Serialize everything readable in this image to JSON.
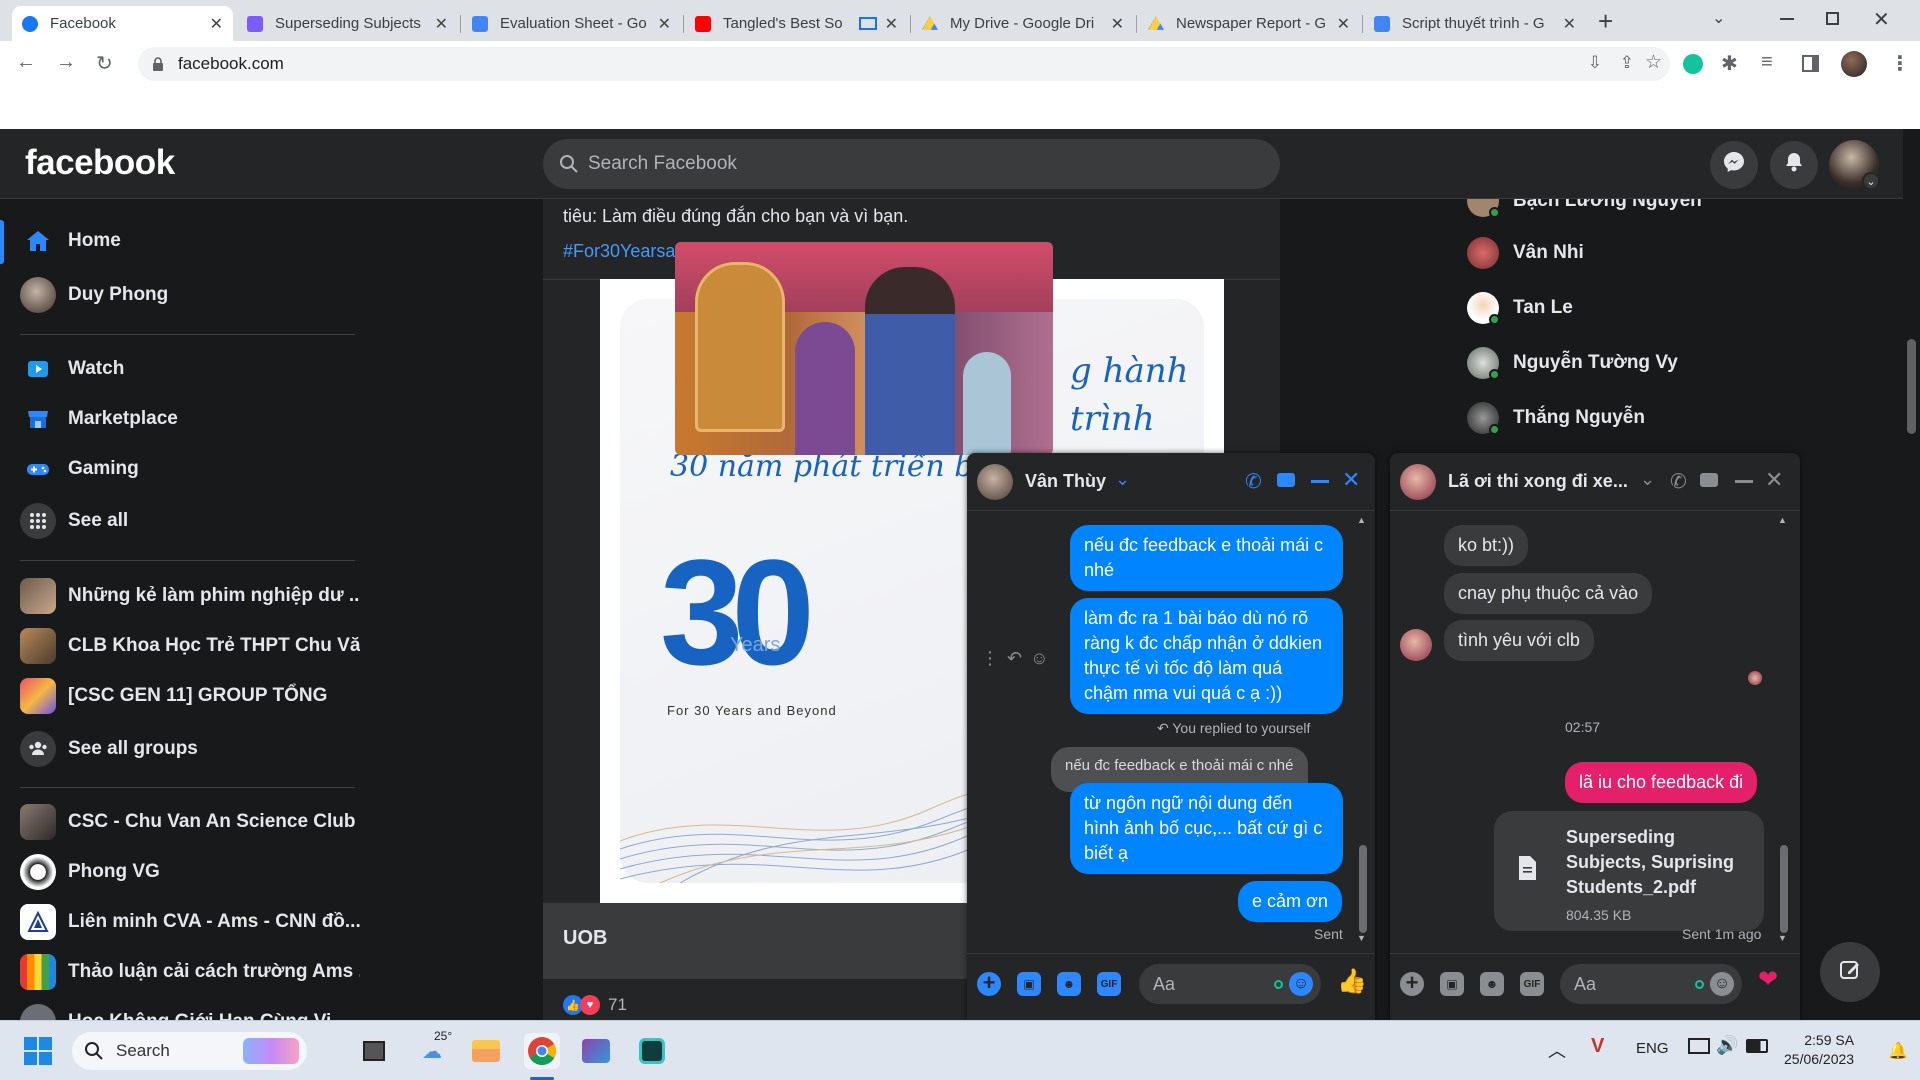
{
  "browser": {
    "tabs": [
      {
        "title": "Facebook",
        "icon_color": "#1877f2",
        "active": true
      },
      {
        "title": "Superseding Subjects",
        "icon_color": "#7b5cff"
      },
      {
        "title": "Evaluation Sheet - Go",
        "icon_color": "#4285f4"
      },
      {
        "title": "Tangled's Best So",
        "icon_color": "#ff0000"
      },
      {
        "title": "My Drive - Google Dri",
        "icon_color": "#34a853"
      },
      {
        "title": "Newspaper Report - G",
        "icon_color": "#fbbc04"
      },
      {
        "title": "Script thuyết trình - G",
        "icon_color": "#4285f4"
      }
    ],
    "new_tab_icon": "plus-icon",
    "url": "facebook.com"
  },
  "fb": {
    "logo": "facebook",
    "search_placeholder": "Search Facebook",
    "nav": {
      "home": "Home",
      "profile": "Duy Phong",
      "watch": "Watch",
      "marketplace": "Marketplace",
      "gaming": "Gaming",
      "see_all": "See all",
      "groups": [
        "Những kẻ làm phim nghiệp dư ...",
        "CLB Khoa Học Trẻ THPT Chu Vă...",
        "[CSC GEN 11] GROUP TỔNG"
      ],
      "see_all_groups": "See all groups",
      "shortcuts": [
        "CSC - Chu Van An Science Club ...",
        "Phong VG",
        "Liên minh CVA - Ams - CNN đồ...",
        "Thảo luận cải cách trường Ams ...",
        "Học Không Giới Hạn Cùng Vi..."
      ]
    },
    "post": {
      "text_line": "tiêu: Làm điều đúng đắn cho bạn và vì bạn.",
      "hashtag": "#For30Yearsa",
      "image_headline_1": "g hành",
      "image_headline_2": "trình",
      "image_subline": "30 năm phát triển b",
      "big_number": "30",
      "years_word": "Years",
      "tagline": "For 30 Years and Beyond",
      "page_name": "UOB",
      "reaction_count": "71"
    },
    "contacts": [
      "Bạch Lương Nguyễn",
      "Vân Nhi",
      "Tan Le",
      "Nguyễn Tường Vy",
      "Thắng Nguyễn"
    ]
  },
  "chat1": {
    "name": "Vân Thùy",
    "messages_out": [
      "nếu đc feedback e thoải mái c nhé",
      "làm đc ra 1 bài báo dù nó rõ ràng k đc chấp nhận ở ddkien thực tế vì tốc độ làm quá chậm nma vui quá c ạ :))"
    ],
    "reply_note": "You replied to yourself",
    "quoted": "nếu đc feedback e thoải mái c nhé",
    "reply_msg": "từ ngôn ngữ nội dung đến hình ảnh bố cục,... bất cứ gì c biết ạ",
    "last_msg": "e cảm ơn",
    "status": "Sent",
    "compose_placeholder": "Aa",
    "gif_label": "GIF"
  },
  "chat2": {
    "name": "Lã ơi thi xong đi xe...",
    "messages_in": [
      "ko bt:))",
      "cnay phụ thuộc cả vào",
      "tình yêu với clb"
    ],
    "time": "02:57",
    "out_msg": "lã iu cho feedback đi",
    "file_name": "Superseding Subjects, Suprising Students_2.pdf",
    "file_size": "804.35 KB",
    "status": "Sent 1m ago",
    "compose_placeholder": "Aa",
    "gif_label": "GIF"
  },
  "taskbar": {
    "search": "Search",
    "weather": "25°",
    "lang": "ENG",
    "time": "2:59 SA",
    "date": "25/06/2023"
  }
}
